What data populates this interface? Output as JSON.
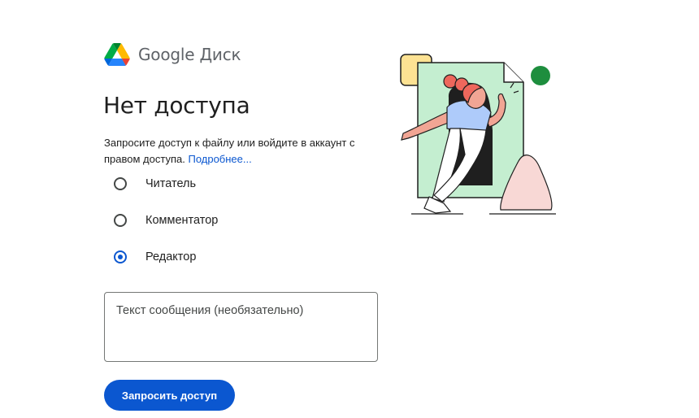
{
  "brand": {
    "name": "Google Диск",
    "logo_icon": "google-drive-logo"
  },
  "title": "Нет доступа",
  "description": {
    "text": "Запросите доступ к файлу или войдите в аккаунт с правом доступа.",
    "link": "Подробнее..."
  },
  "roles": [
    {
      "label": "Читатель",
      "checked": false
    },
    {
      "label": "Комментатор",
      "checked": false
    },
    {
      "label": "Редактор",
      "checked": true
    }
  ],
  "message": {
    "placeholder": "Текст сообщения (необязательно)",
    "value": ""
  },
  "request_button": {
    "label": "Запросить доступ"
  },
  "colors": {
    "primary": "#0b57d0",
    "text": "#1f1f1f",
    "muted": "#5f6368"
  }
}
